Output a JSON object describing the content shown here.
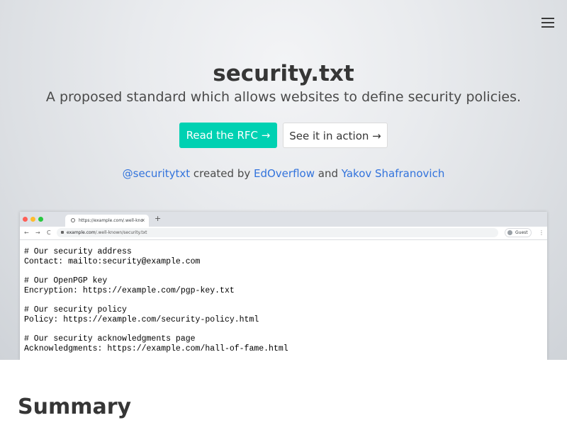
{
  "header": {
    "menu_icon": "hamburger-menu-icon"
  },
  "hero": {
    "title": "security.txt",
    "subtitle": "A proposed standard which allows websites to define security policies.",
    "primary_button": "Read the RFC →",
    "secondary_button": "See it in action →",
    "credits": {
      "handle": "@securitytxt",
      "created_by": " created by ",
      "author1": "EdOverflow",
      "and": " and ",
      "author2": "Yakov Shafranovich"
    }
  },
  "browser": {
    "tab_title": "https://example.com/.well-kno",
    "tab_close": "×",
    "new_tab": "+",
    "nav": {
      "back": "←",
      "forward": "→",
      "reload": "C"
    },
    "url_domain": "example.com",
    "url_path": "/.well-known/security.txt",
    "guest_label": "Guest",
    "menu_icon": "⋮",
    "traffic_light_colors": [
      "#ff5f57",
      "#febc2e",
      "#28c840"
    ],
    "content": [
      [
        "# Our security address",
        "Contact: mailto:security@example.com"
      ],
      [
        "# Our OpenPGP key",
        "Encryption: https://example.com/pgp-key.txt"
      ],
      [
        "# Our security policy",
        "Policy: https://example.com/security-policy.html"
      ],
      [
        "# Our security acknowledgments page",
        "Acknowledgments: https://example.com/hall-of-fame.html"
      ]
    ]
  },
  "main": {
    "section_title": "Summary"
  },
  "colors": {
    "accent": "#00d1b2",
    "link": "#3273dc",
    "text": "#363636"
  }
}
